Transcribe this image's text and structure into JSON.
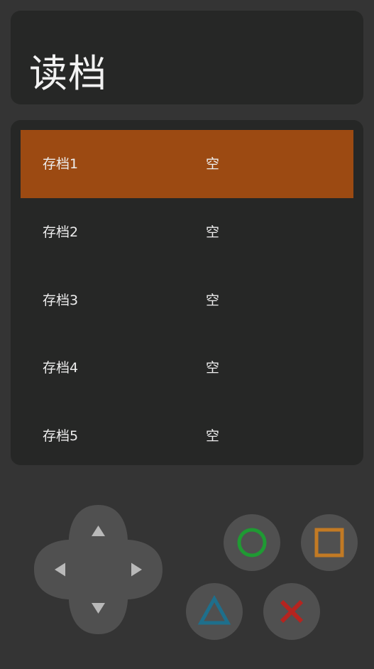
{
  "page": {
    "title": "读档"
  },
  "slots": [
    {
      "name": "存档1",
      "status": "空",
      "selected": true
    },
    {
      "name": "存档2",
      "status": "空",
      "selected": false
    },
    {
      "name": "存档3",
      "status": "空",
      "selected": false
    },
    {
      "name": "存档4",
      "status": "空",
      "selected": false
    },
    {
      "name": "存档5",
      "status": "空",
      "selected": false
    }
  ],
  "controls": {
    "dpad": [
      "up-arrow-icon",
      "down-arrow-icon",
      "left-arrow-icon",
      "right-arrow-icon"
    ],
    "buttons": [
      {
        "name": "circle-button",
        "icon": "circle-icon",
        "color": "#1f9a33"
      },
      {
        "name": "square-button",
        "icon": "square-icon",
        "color": "#c27a24"
      },
      {
        "name": "triangle-button",
        "icon": "triangle-icon",
        "color": "#1e6f8c"
      },
      {
        "name": "cross-button",
        "icon": "cross-icon",
        "color": "#b5241f"
      }
    ]
  },
  "colors": {
    "background": "#343434",
    "panel": "#262726",
    "selected_slot": "#9c4a12",
    "button": "#505050",
    "dpad": "#505050",
    "dpad_arrow": "#b9b9b9"
  }
}
